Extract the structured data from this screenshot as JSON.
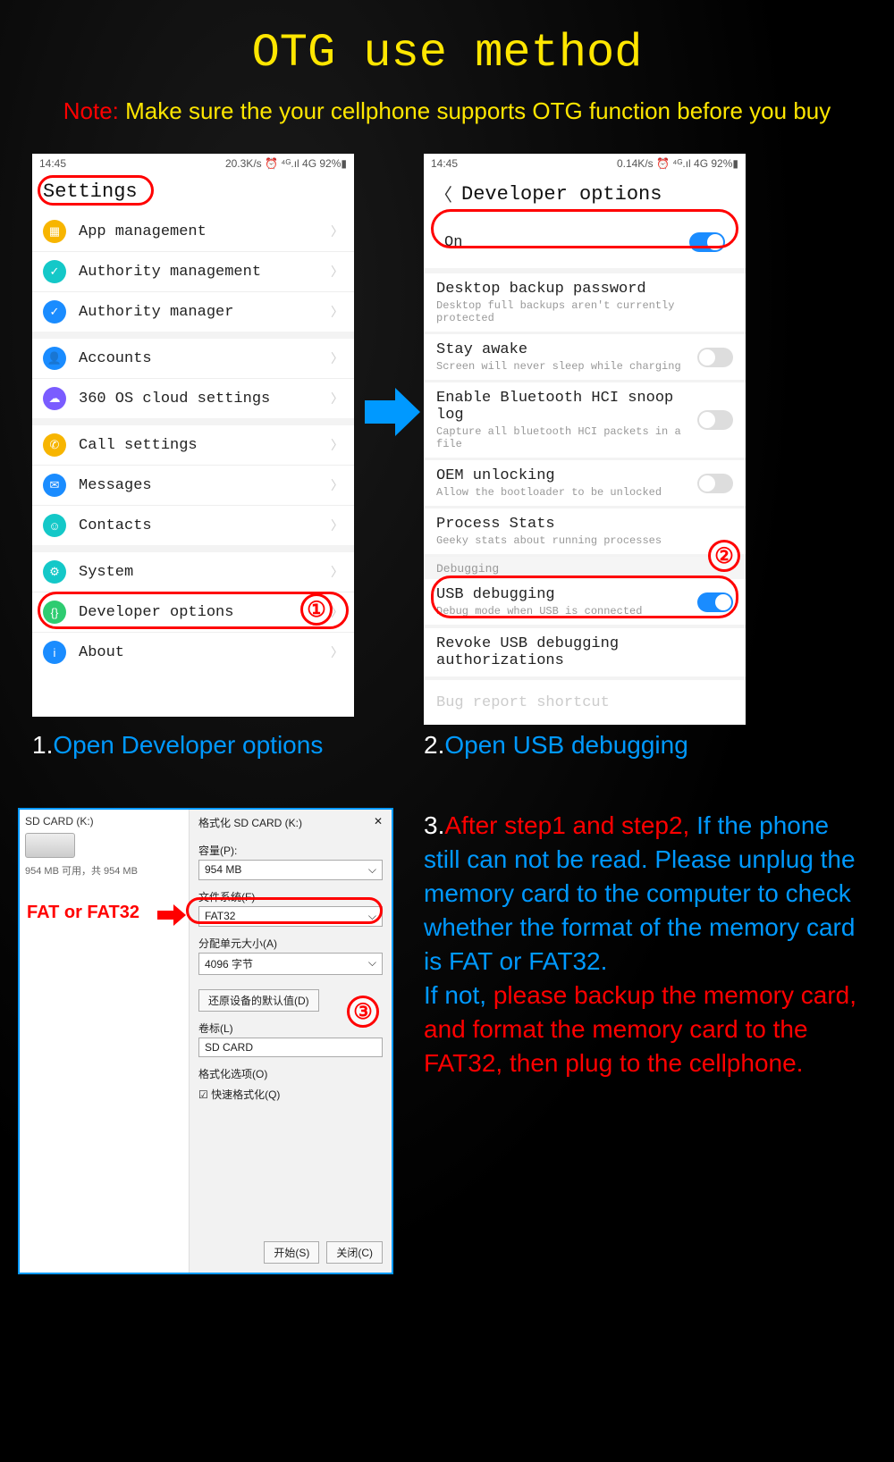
{
  "header": {
    "title": "OTG use method",
    "note_prefix": "Note:",
    "note_text": "Make sure the your cellphone supports OTG function before you buy"
  },
  "phone1": {
    "status_time": "14:45",
    "status_right": "20.3K/s ⏰ ⁴ᴳ.ıl 4G 92%▮",
    "title": "Settings",
    "items": [
      {
        "icon_color": "#f7b500",
        "label": "App management",
        "glyph": "▦"
      },
      {
        "icon_color": "#14c8c8",
        "label": "Authority management",
        "glyph": "✓"
      },
      {
        "icon_color": "#1a8cff",
        "label": "Authority manager",
        "glyph": "✓"
      }
    ],
    "items2": [
      {
        "icon_color": "#1a8cff",
        "label": "Accounts",
        "glyph": "👤"
      },
      {
        "icon_color": "#7a5cff",
        "label": "360 OS cloud settings",
        "glyph": "☁"
      }
    ],
    "items3": [
      {
        "icon_color": "#f7b500",
        "label": "Call settings",
        "glyph": "✆"
      },
      {
        "icon_color": "#1a8cff",
        "label": "Messages",
        "glyph": "✉"
      },
      {
        "icon_color": "#14c8c8",
        "label": "Contacts",
        "glyph": "☺"
      }
    ],
    "items4": [
      {
        "icon_color": "#14c8c8",
        "label": "System",
        "glyph": "⚙"
      },
      {
        "icon_color": "#2ecc71",
        "label": "Developer options",
        "glyph": "{}"
      },
      {
        "icon_color": "#1a8cff",
        "label": "About",
        "glyph": "i"
      }
    ]
  },
  "phone2": {
    "status_time": "14:45",
    "status_right": "0.14K/s ⏰ ⁴ᴳ.ıl 4G 92%▮",
    "title": "Developer options",
    "on_label": "On",
    "items": [
      {
        "title": "Desktop backup password",
        "sub": "Desktop full backups aren't currently protected",
        "toggle": null
      },
      {
        "title": "Stay awake",
        "sub": "Screen will never sleep while charging",
        "toggle": "off"
      },
      {
        "title": "Enable Bluetooth HCI snoop log",
        "sub": "Capture all bluetooth HCI packets in a file",
        "toggle": "off"
      },
      {
        "title": "OEM unlocking",
        "sub": "Allow the bootloader to be unlocked",
        "toggle": "off"
      },
      {
        "title": "Process Stats",
        "sub": "Geeky stats about running processes",
        "toggle": null
      }
    ],
    "debug_section": "Debugging",
    "usb_debug": {
      "title": "USB debugging",
      "sub": "Debug mode when USB is connected"
    },
    "revoke": "Revoke USB debugging authorizations",
    "bug_report": "Bug report shortcut"
  },
  "captions": {
    "cap1_num": "1.",
    "cap1_text": "Open Developer options",
    "cap2_num": "2.",
    "cap2_text": "Open USB debugging"
  },
  "dialog": {
    "left_title": "SD CARD (K:)",
    "left_sub": "954 MB 可用，共 954 MB",
    "title": "格式化 SD CARD (K:)",
    "capacity_label": "容量(P):",
    "capacity_value": "954 MB",
    "fs_label": "文件系统(F)",
    "fs_value": "FAT32",
    "alloc_label": "分配单元大小(A)",
    "alloc_value": "4096 字节",
    "restore_btn": "还原设备的默认值(D)",
    "vol_label": "卷标(L)",
    "vol_value": "SD CARD",
    "opts_label": "格式化选项(O)",
    "quick_format": "快速格式化(Q)",
    "start_btn": "开始(S)",
    "close_btn": "关闭(C)"
  },
  "fat_label": "FAT or FAT32",
  "step3": {
    "num": "3.",
    "red1": "After step1 and step2,",
    "blue1": "If the phone still can not be read. Please unplug the memory card to the computer to check whether the format of the memory card is FAT or FAT32.",
    "blue2": "If not, ",
    "red2": "please backup the memory card, and format the memory card to the FAT32, then plug to the cellphone."
  },
  "circled": {
    "one": "①",
    "two": "②",
    "three": "③"
  }
}
